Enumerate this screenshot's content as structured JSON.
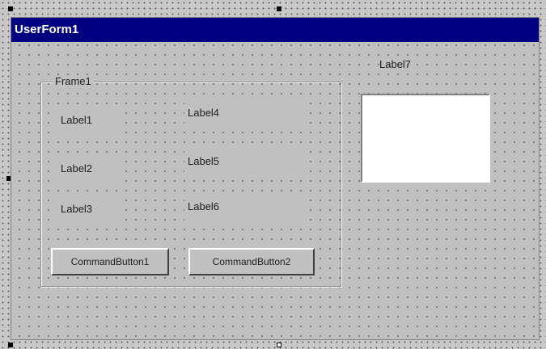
{
  "form": {
    "title": "UserForm1"
  },
  "frame": {
    "caption": "Frame1"
  },
  "labels": {
    "label1": "Label1",
    "label2": "Label2",
    "label3": "Label3",
    "label4": "Label4",
    "label5": "Label5",
    "label6": "Label6",
    "label7": "Label7"
  },
  "buttons": {
    "command1": "CommandButton1",
    "command2": "CommandButton2"
  },
  "textbox": {
    "value": ""
  }
}
